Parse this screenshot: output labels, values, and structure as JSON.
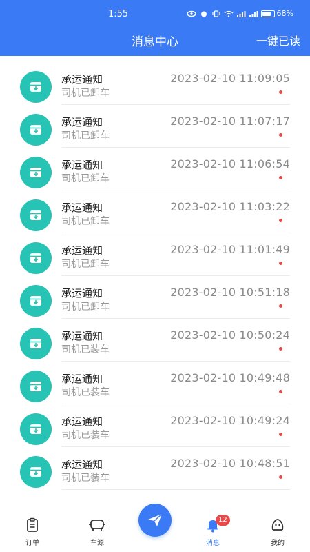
{
  "status_bar": {
    "time": "1:55",
    "battery": "68%"
  },
  "header": {
    "title": "消息中心",
    "read_all": "一键已读"
  },
  "messages": [
    {
      "title": "承运通知",
      "subtitle": "司机已卸车",
      "time": "2023-02-10 11:09:05",
      "unread": true
    },
    {
      "title": "承运通知",
      "subtitle": "司机已卸车",
      "time": "2023-02-10 11:07:17",
      "unread": true
    },
    {
      "title": "承运通知",
      "subtitle": "司机已卸车",
      "time": "2023-02-10 11:06:54",
      "unread": true
    },
    {
      "title": "承运通知",
      "subtitle": "司机已卸车",
      "time": "2023-02-10 11:03:22",
      "unread": true
    },
    {
      "title": "承运通知",
      "subtitle": "司机已卸车",
      "time": "2023-02-10 11:01:49",
      "unread": true
    },
    {
      "title": "承运通知",
      "subtitle": "司机已卸车",
      "time": "2023-02-10 10:51:18",
      "unread": true
    },
    {
      "title": "承运通知",
      "subtitle": "司机已装车",
      "time": "2023-02-10 10:50:24",
      "unread": true
    },
    {
      "title": "承运通知",
      "subtitle": "司机已装车",
      "time": "2023-02-10 10:49:48",
      "unread": true
    },
    {
      "title": "承运通知",
      "subtitle": "司机已装车",
      "time": "2023-02-10 10:49:24",
      "unread": true
    },
    {
      "title": "承运通知",
      "subtitle": "司机已装车",
      "time": "2023-02-10 10:48:51",
      "unread": true
    }
  ],
  "tabbar": {
    "orders": "订单",
    "vehicles": "车源",
    "messages": "消息",
    "messages_badge": "12",
    "mine": "我的"
  },
  "colors": {
    "primary": "#3a7af5",
    "teal": "#27c3b4",
    "unread_dot": "#e84a4a"
  }
}
